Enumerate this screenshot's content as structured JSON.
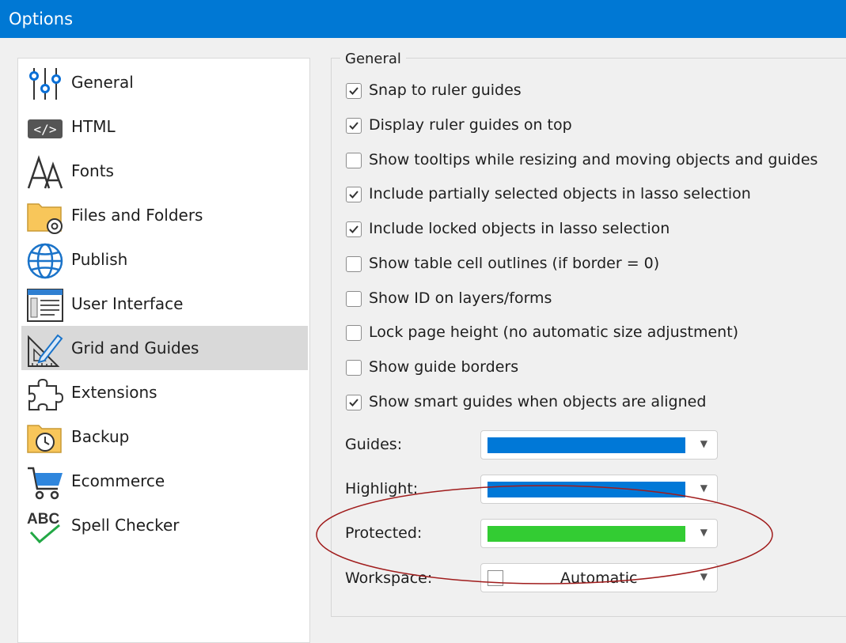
{
  "window": {
    "title": "Options",
    "accent": "#0078d4"
  },
  "nav": {
    "items": [
      {
        "label": "General",
        "icon": "sliders-icon"
      },
      {
        "label": "HTML",
        "icon": "code-icon"
      },
      {
        "label": "Fonts",
        "icon": "font-icon"
      },
      {
        "label": "Files and Folders",
        "icon": "folder-gear-icon"
      },
      {
        "label": "Publish",
        "icon": "globe-icon"
      },
      {
        "label": "User Interface",
        "icon": "window-icon"
      },
      {
        "label": "Grid and Guides",
        "icon": "ruler-pencil-icon",
        "selected": true
      },
      {
        "label": "Extensions",
        "icon": "puzzle-icon"
      },
      {
        "label": "Backup",
        "icon": "folder-clock-icon"
      },
      {
        "label": "Ecommerce",
        "icon": "cart-icon"
      },
      {
        "label": "Spell Checker",
        "icon": "abc-check-icon"
      }
    ]
  },
  "general": {
    "legend": "General",
    "options": [
      {
        "label": "Snap to ruler guides",
        "checked": true
      },
      {
        "label": "Display ruler guides on top",
        "checked": true
      },
      {
        "label": "Show tooltips while resizing and moving objects and guides",
        "checked": false
      },
      {
        "label": "Include partially selected objects in lasso selection",
        "checked": true
      },
      {
        "label": "Include locked objects in lasso selection",
        "checked": true
      },
      {
        "label": "Show table cell outlines (if border = 0)",
        "checked": false
      },
      {
        "label": "Show ID on layers/forms",
        "checked": false
      },
      {
        "label": "Lock page height (no automatic size adjustment)",
        "checked": false
      },
      {
        "label": "Show guide borders",
        "checked": false
      },
      {
        "label": "Show smart guides when objects are aligned",
        "checked": true
      }
    ]
  },
  "colors": {
    "guides": {
      "label": "Guides:",
      "color": "#0078d7"
    },
    "highlight": {
      "label": "Highlight:",
      "color": "#0078d7"
    },
    "protected": {
      "label": "Protected:",
      "color": "#33cc33"
    },
    "workspace": {
      "label": "Workspace:",
      "value": "Automatic"
    }
  }
}
